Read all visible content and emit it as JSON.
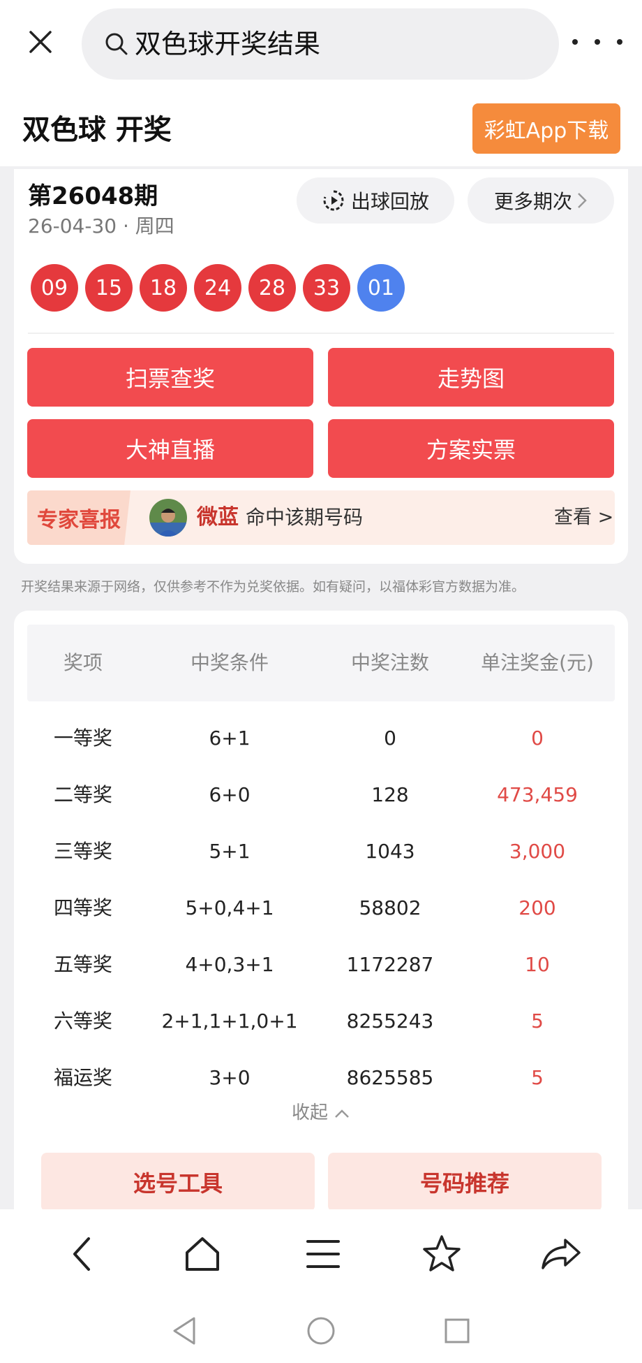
{
  "search": {
    "query": "双色球开奖结果"
  },
  "header": {
    "title": "双色球 开奖",
    "download_label": "彩虹App下载"
  },
  "draw": {
    "issue": "第26048期",
    "date": "26-04-30 · 周四",
    "replay_label": "出球回放",
    "more_issues_label": "更多期次",
    "red_balls": [
      "09",
      "15",
      "18",
      "24",
      "28",
      "33"
    ],
    "blue_ball": "01"
  },
  "actions": {
    "scan": "扫票查奖",
    "trend": "走势图",
    "live": "大神直播",
    "plan": "方案实票"
  },
  "expert": {
    "tag": "专家喜报",
    "name": "微蓝",
    "text": "命中该期号码",
    "view": "查看 >"
  },
  "disclaimer": "开奖结果来源于网络，仅供参考不作为兑奖依据。如有疑问，以福体彩官方数据为准。",
  "prize_table": {
    "headers": [
      "奖项",
      "中奖条件",
      "中奖注数",
      "单注奖金(元)"
    ],
    "rows": [
      [
        "一等奖",
        "6+1",
        "0",
        "0"
      ],
      [
        "二等奖",
        "6+0",
        "128",
        "473,459"
      ],
      [
        "三等奖",
        "5+1",
        "1043",
        "3,000"
      ],
      [
        "四等奖",
        "5+0,4+1",
        "58802",
        "200"
      ],
      [
        "五等奖",
        "4+0,3+1",
        "1172287",
        "10"
      ],
      [
        "六等奖",
        "2+1,1+1,0+1",
        "8255243",
        "5"
      ],
      [
        "福运奖",
        "3+0",
        "8625585",
        "5"
      ]
    ]
  },
  "collapse_label": "收起",
  "tools": {
    "picker": "选号工具",
    "recommend": "号码推荐"
  },
  "colors": {
    "red_ball": "#e5393d",
    "blue_ball": "#4f82ee",
    "primary_button": "#f24b4f",
    "download_button": "#f58b3c",
    "money": "#e04a46"
  },
  "icons": {
    "close": "close-icon",
    "search": "search-icon",
    "more": "more-dots-icon",
    "replay": "replay-icon",
    "chevron": "chevron-right-icon",
    "nav": [
      "back-arrow-icon",
      "home-icon",
      "menu-icon",
      "star-icon",
      "share-icon"
    ],
    "system": [
      "system-back-icon",
      "system-home-icon",
      "system-recents-icon"
    ]
  }
}
